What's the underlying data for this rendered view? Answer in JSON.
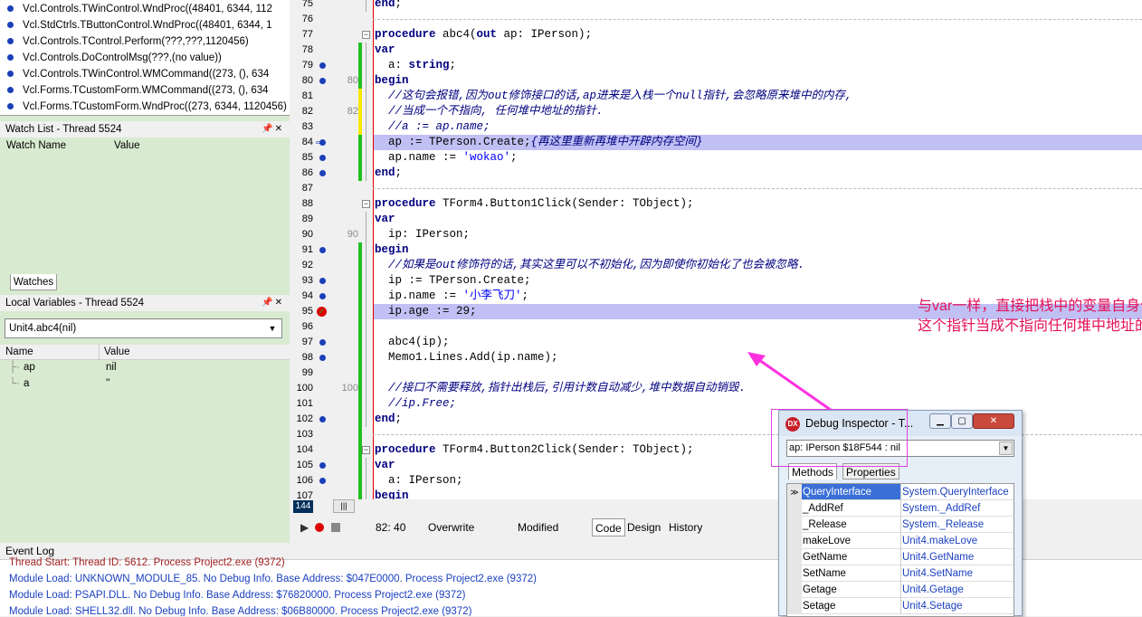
{
  "call_stack": [
    "Vcl.Controls.TWinControl.WndProc((48401, 6344, 112",
    "Vcl.StdCtrls.TButtonControl.WndProc((48401, 6344, 1",
    "Vcl.Controls.TControl.Perform(???,???,1120456)",
    "Vcl.Controls.DoControlMsg(???,(no value))",
    "Vcl.Controls.TWinControl.WMCommand((273, (), 634",
    "Vcl.Forms.TCustomForm.WMCommand((273, (), 634",
    "Vcl.Forms.TCustomForm.WndProc((273, 6344, 1120456)"
  ],
  "watch": {
    "title": "Watch List - Thread 5524",
    "col_name": "Watch Name",
    "col_value": "Value",
    "tab": "Watches"
  },
  "locals": {
    "title": "Local Variables - Thread 5524",
    "selected": "Unit4.abc4(nil)",
    "col_name": "Name",
    "col_value": "Value",
    "rows": [
      {
        "name": "ap",
        "value": "nil"
      },
      {
        "name": "a",
        "value": "''"
      }
    ]
  },
  "editor": {
    "lines": [
      {
        "n": "75",
        "g": "",
        "code": "end;"
      },
      {
        "n": "76",
        "g": "",
        "code": ""
      },
      {
        "n": "77",
        "g": "",
        "code": "procedure abc4(out ap: IPerson);"
      },
      {
        "n": "78",
        "g": "",
        "code": "var"
      },
      {
        "n": "79",
        "g": "",
        "code": "  a: string;"
      },
      {
        "n": "80",
        "g": "80",
        "code": "begin"
      },
      {
        "n": "81",
        "g": "",
        "code": "  //这句会报错,因为out修饰接口的话,ap进来是入栈一个null指针,会忽略原来堆中的内存,"
      },
      {
        "n": "82",
        "g": "82",
        "code": "  //当成一个不指向, 任何堆中地址的指针."
      },
      {
        "n": "83",
        "g": "",
        "code": "  //a := ap.name;"
      },
      {
        "n": "84",
        "g": "",
        "code": "  ap := TPerson.Create;{再这里重新再堆中开辟内存空间}"
      },
      {
        "n": "85",
        "g": "",
        "code": "  ap.name := 'wokao';"
      },
      {
        "n": "86",
        "g": "",
        "code": "end;"
      },
      {
        "n": "87",
        "g": "",
        "code": ""
      },
      {
        "n": "88",
        "g": "",
        "code": "procedure TForm4.Button1Click(Sender: TObject);"
      },
      {
        "n": "89",
        "g": "",
        "code": "var"
      },
      {
        "n": "90",
        "g": "90",
        "code": "  ip: IPerson;"
      },
      {
        "n": "91",
        "g": "",
        "code": "begin"
      },
      {
        "n": "92",
        "g": "",
        "code": "  //如果是out修饰符的话,其实这里可以不初始化,因为即使你初始化了也会被忽略."
      },
      {
        "n": "93",
        "g": "",
        "code": "  ip := TPerson.Create;"
      },
      {
        "n": "94",
        "g": "",
        "code": "  ip.name := '小李飞刀';"
      },
      {
        "n": "95",
        "g": "",
        "code": "  ip.age := 29;"
      },
      {
        "n": "96",
        "g": "",
        "code": ""
      },
      {
        "n": "97",
        "g": "",
        "code": "  abc4(ip);"
      },
      {
        "n": "98",
        "g": "",
        "code": "  Memo1.Lines.Add(ip.name);"
      },
      {
        "n": "99",
        "g": "",
        "code": ""
      },
      {
        "n": "100",
        "g": "100",
        "code": "  //接口不需要释放,指针出栈后,引用计数自动减少,堆中数据自动销毁."
      },
      {
        "n": "101",
        "g": "",
        "code": "  //ip.Free;"
      },
      {
        "n": "102",
        "g": "",
        "code": "end;"
      },
      {
        "n": "103",
        "g": "",
        "code": ""
      },
      {
        "n": "104",
        "g": "",
        "code": "procedure TForm4.Button2Click(Sender: TObject);"
      },
      {
        "n": "105",
        "g": "",
        "code": "var"
      },
      {
        "n": "106",
        "g": "",
        "code": "  a: IPerson;"
      },
      {
        "n": "107",
        "g": "",
        "code": "begin"
      }
    ],
    "annotation": "与var一样，直接把栈中的变量自身传递过来，但是会忽略原来堆中的内存，把这个指针当成不指向任何堆中地址的空指针。"
  },
  "status": {
    "cursor": "82: 40",
    "mode": "Overwrite",
    "modified": "Modified",
    "tabs": [
      "Code",
      "Design",
      "History"
    ],
    "line_marker": "144"
  },
  "event_log": {
    "title": "Event Log",
    "entries": [
      "Thread Start: Thread ID: 5612. Process Project2.exe (9372)",
      "Module Load: UNKNOWN_MODULE_85. No Debug Info. Base Address: $047E0000. Process Project2.exe (9372)",
      "Module Load: PSAPI.DLL. No Debug Info. Base Address: $76820000. Process Project2.exe (9372)",
      "Module Load: SHELL32.dll. No Debug Info. Base Address: $06B80000. Process Project2.exe (9372)"
    ]
  },
  "debug_inspector": {
    "title": "Debug Inspector - T...",
    "icon_text": "DX",
    "selector": "ap: IPerson $18F544 : nil",
    "tabs": [
      "Methods",
      "Properties"
    ],
    "rows": [
      {
        "name": "QueryInterface",
        "value": "System.QueryInterface"
      },
      {
        "name": "_AddRef",
        "value": "System._AddRef"
      },
      {
        "name": "_Release",
        "value": "System._Release"
      },
      {
        "name": "makeLove",
        "value": "Unit4.makeLove"
      },
      {
        "name": "GetName",
        "value": "Unit4.GetName"
      },
      {
        "name": "SetName",
        "value": "Unit4.SetName"
      },
      {
        "name": "Getage",
        "value": "Unit4.Getage"
      },
      {
        "name": "Setage",
        "value": "Unit4.Setage"
      }
    ]
  },
  "colors": {
    "highlight": "#c0c0f4",
    "annotation": "#e4105a",
    "panel_bg": "#d8ead0"
  }
}
